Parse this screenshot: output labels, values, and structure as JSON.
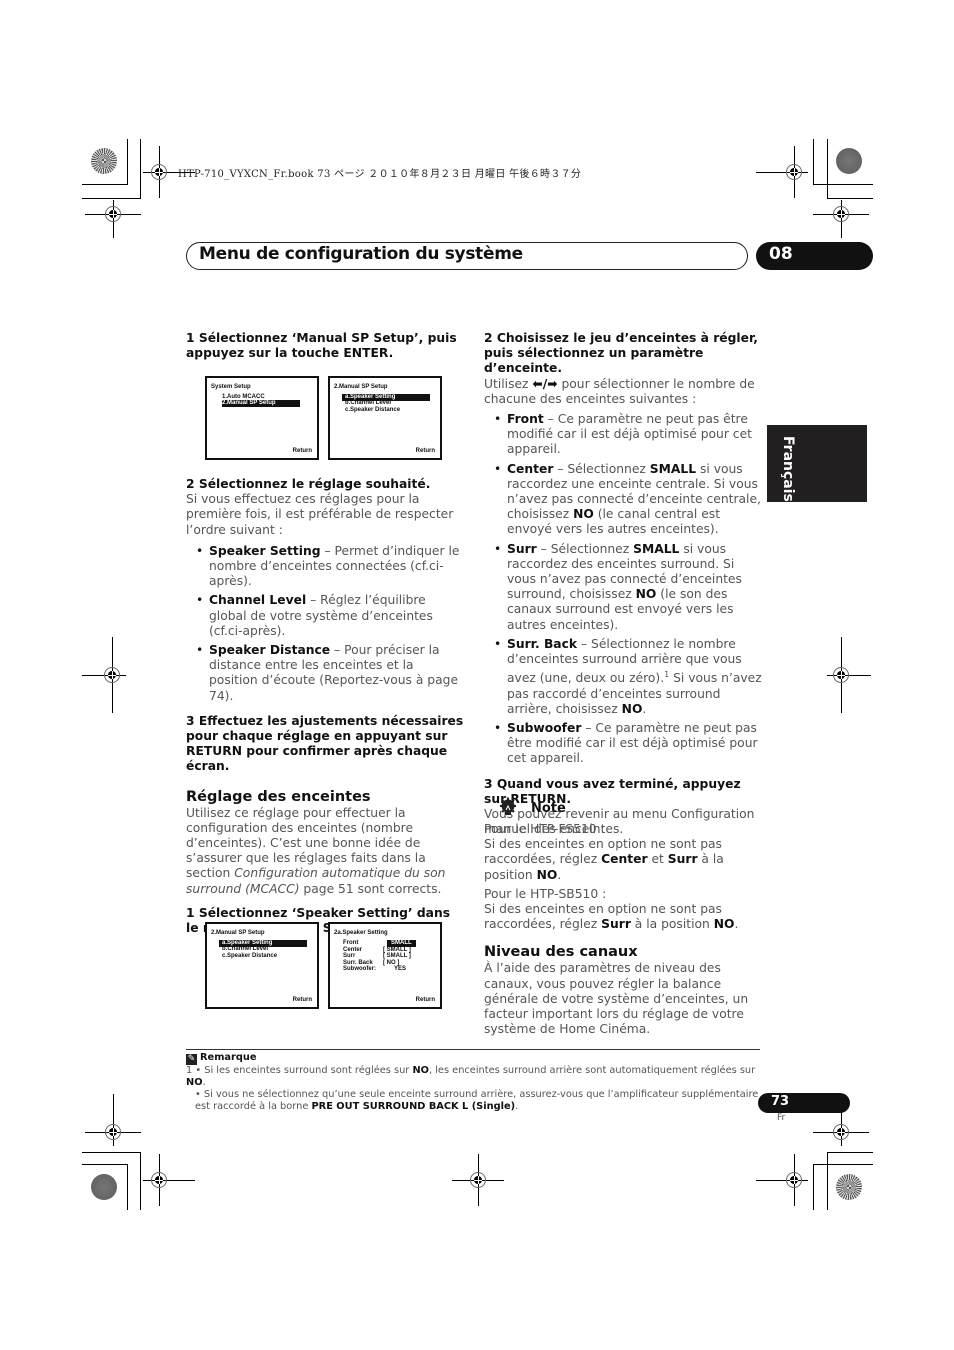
{
  "print_info": "HTP-710_VYXCN_Fr.book  73 ページ  ２０１０年８月２３日  月曜日  午後６時３７分",
  "header": {
    "title": "Menu de configuration du système",
    "chapter": "08"
  },
  "language_tab": "Français",
  "left_column": {
    "step1": "1    Sélectionnez ‘Manual SP Setup’, puis appuyez sur la touche ENTER.",
    "screens_top": [
      {
        "title": "System  Setup",
        "items": [
          "1.Auto  MCACC",
          "2.Manual  SP  Setup"
        ],
        "selected_index": 1,
        "return": "Return"
      },
      {
        "title": "2.Manual  SP  Setup",
        "items": [
          "a.Speaker  Setting",
          "b.Channel  Level",
          "c.Speaker  Distance"
        ],
        "selected_index": 0,
        "return": "Return"
      }
    ],
    "step2": "2    Sélectionnez le réglage souhaité.",
    "step2_body": "Si vous effectuez ces réglages pour la première fois, il est préférable de respecter l’ordre suivant :",
    "bullets": [
      {
        "term": "Speaker Setting",
        "text": " – Permet d’indiquer le nombre d’enceintes connectées (cf.ci-après)."
      },
      {
        "term": "Channel Level",
        "text": " – Réglez l’équilibre global de votre système d’enceintes (cf.ci-après)."
      },
      {
        "term": "Speaker Distance",
        "text": " – Pour préciser la distance entre les enceintes et la position d’écoute (Reportez-vous à page 74)."
      }
    ],
    "step3": "3    Effectuez les ajustements nécessaires pour chaque réglage en appuyant sur RETURN pour confirmer après chaque écran.",
    "section_title": "Réglage des enceintes",
    "section_body_pre": "Utilisez ce réglage pour effectuer la configuration des enceintes (nombre d’enceintes). C’est une bonne idée de s’assurer que les réglages faits dans la section ",
    "section_body_italic": "Configuration automatique du son surround (MCACC)",
    "section_body_post": " page 51 sont corrects.",
    "step1b": "1    Sélectionnez ‘Speaker Setting’ dans le menu Manual SP Setup.",
    "screens_bottom": [
      {
        "title": "2.Manual  SP  Setup",
        "items": [
          "a.Speaker  Setting",
          "b.Channel  Level",
          "c.Speaker  Distance"
        ],
        "selected_index": 0,
        "return": "Return"
      },
      {
        "title": "2a.Speaker  Setting",
        "rows": [
          {
            "label": "Front",
            "value": "SMALL"
          },
          {
            "label": "Center",
            "value": "[  SMALL  ]"
          },
          {
            "label": "Surr",
            "value": "[  SMALL  ]"
          },
          {
            "label": "Surr. Back",
            "value": "[    NO    ]"
          },
          {
            "label": "Subwoofer:",
            "value": "YES"
          }
        ],
        "return": "Return"
      }
    ]
  },
  "right_column": {
    "step2": "2    Choisissez le jeu d’enceintes à régler, puis sélectionnez un paramètre d’enceinte.",
    "step2_body_pre": "Utilisez ",
    "arrows": "⬅/➡",
    "step2_body_post": " pour sélectionner le nombre de chacune des enceintes suivantes :",
    "bullets": {
      "front_term": "Front",
      "front_text": " – Ce paramètre ne peut pas être modifié car il est déjà optimisé pour cet appareil.",
      "center_term": "Center",
      "center_t1": " – Sélectionnez ",
      "center_small": "SMALL",
      "center_t2": " si vous raccordez une enceinte centrale. Si vous n’avez pas connecté d’enceinte centrale, choisissez ",
      "center_no": "NO",
      "center_t3": " (le canal central est envoyé vers les autres enceintes).",
      "surr_term": "Surr",
      "surr_t1": " – Sélectionnez ",
      "surr_small": "SMALL",
      "surr_t2": " si vous raccordez des enceintes surround. Si vous n’avez pas connecté d’enceintes surround, choisissez ",
      "surr_no": "NO",
      "surr_t3": " (le son des canaux surround est envoyé vers les autres enceintes).",
      "sb_term": "Surr. Back",
      "sb_t1": " – Sélectionnez le nombre d’enceintes surround arrière que vous avez (une, deux ou zéro).",
      "sb_sup": "1",
      "sb_t2": " Si vous n’avez pas raccordé d’enceintes surround arrière, choisissez ",
      "sb_no": "NO",
      "sb_t3": ".",
      "sub_term": "Subwoofer",
      "sub_text": " – Ce paramètre ne peut pas être modifié car il est déjà optimisé pour cet appareil."
    },
    "step3": "3    Quand vous avez terminé, appuyez sur RETURN.",
    "step3_body": "Vous pouvez revenir au menu Configuration manuel des enceintes.",
    "note": {
      "title": "Note",
      "p1_line1": "Pour le HTP-FS510 :",
      "p1_pre": "Si des enceintes en option ne sont pas raccordées, réglez ",
      "p1_b1": "Center",
      "p1_mid": " et ",
      "p1_b2": "Surr",
      "p1_post": " à la position ",
      "p1_b3": "NO",
      "p1_end": ".",
      "p2_line1": "Pour le HTP-SB510 :",
      "p2_pre": "Si des enceintes en option ne sont pas raccordées, réglez ",
      "p2_b1": "Surr",
      "p2_post": " à la position ",
      "p2_b2": "NO",
      "p2_end": "."
    },
    "section_title": "Niveau des canaux",
    "section_body": "À l’aide des paramètres de niveau des canaux, vous pouvez régler la balance générale de votre système d’enceintes, un facteur important lors du réglage de votre système de Home Cinéma."
  },
  "footnote": {
    "title": "Remarque",
    "n1_pre": "1  • Si les enceintes surround sont réglées sur ",
    "n1_b1": "NO",
    "n1_mid": ", les enceintes surround arrière sont automatiquement réglées sur ",
    "n1_b2": "NO",
    "n1_end": ".",
    "n2_pre": "• Si vous ne sélectionnez qu’une seule enceinte surround arrière, assurez-vous que l’amplificateur supplémentaire est raccordé à la borne ",
    "n2_b": "PRE OUT SURROUND BACK L (Single)",
    "n2_end": "."
  },
  "page": {
    "number": "73",
    "lang": "Fr"
  }
}
